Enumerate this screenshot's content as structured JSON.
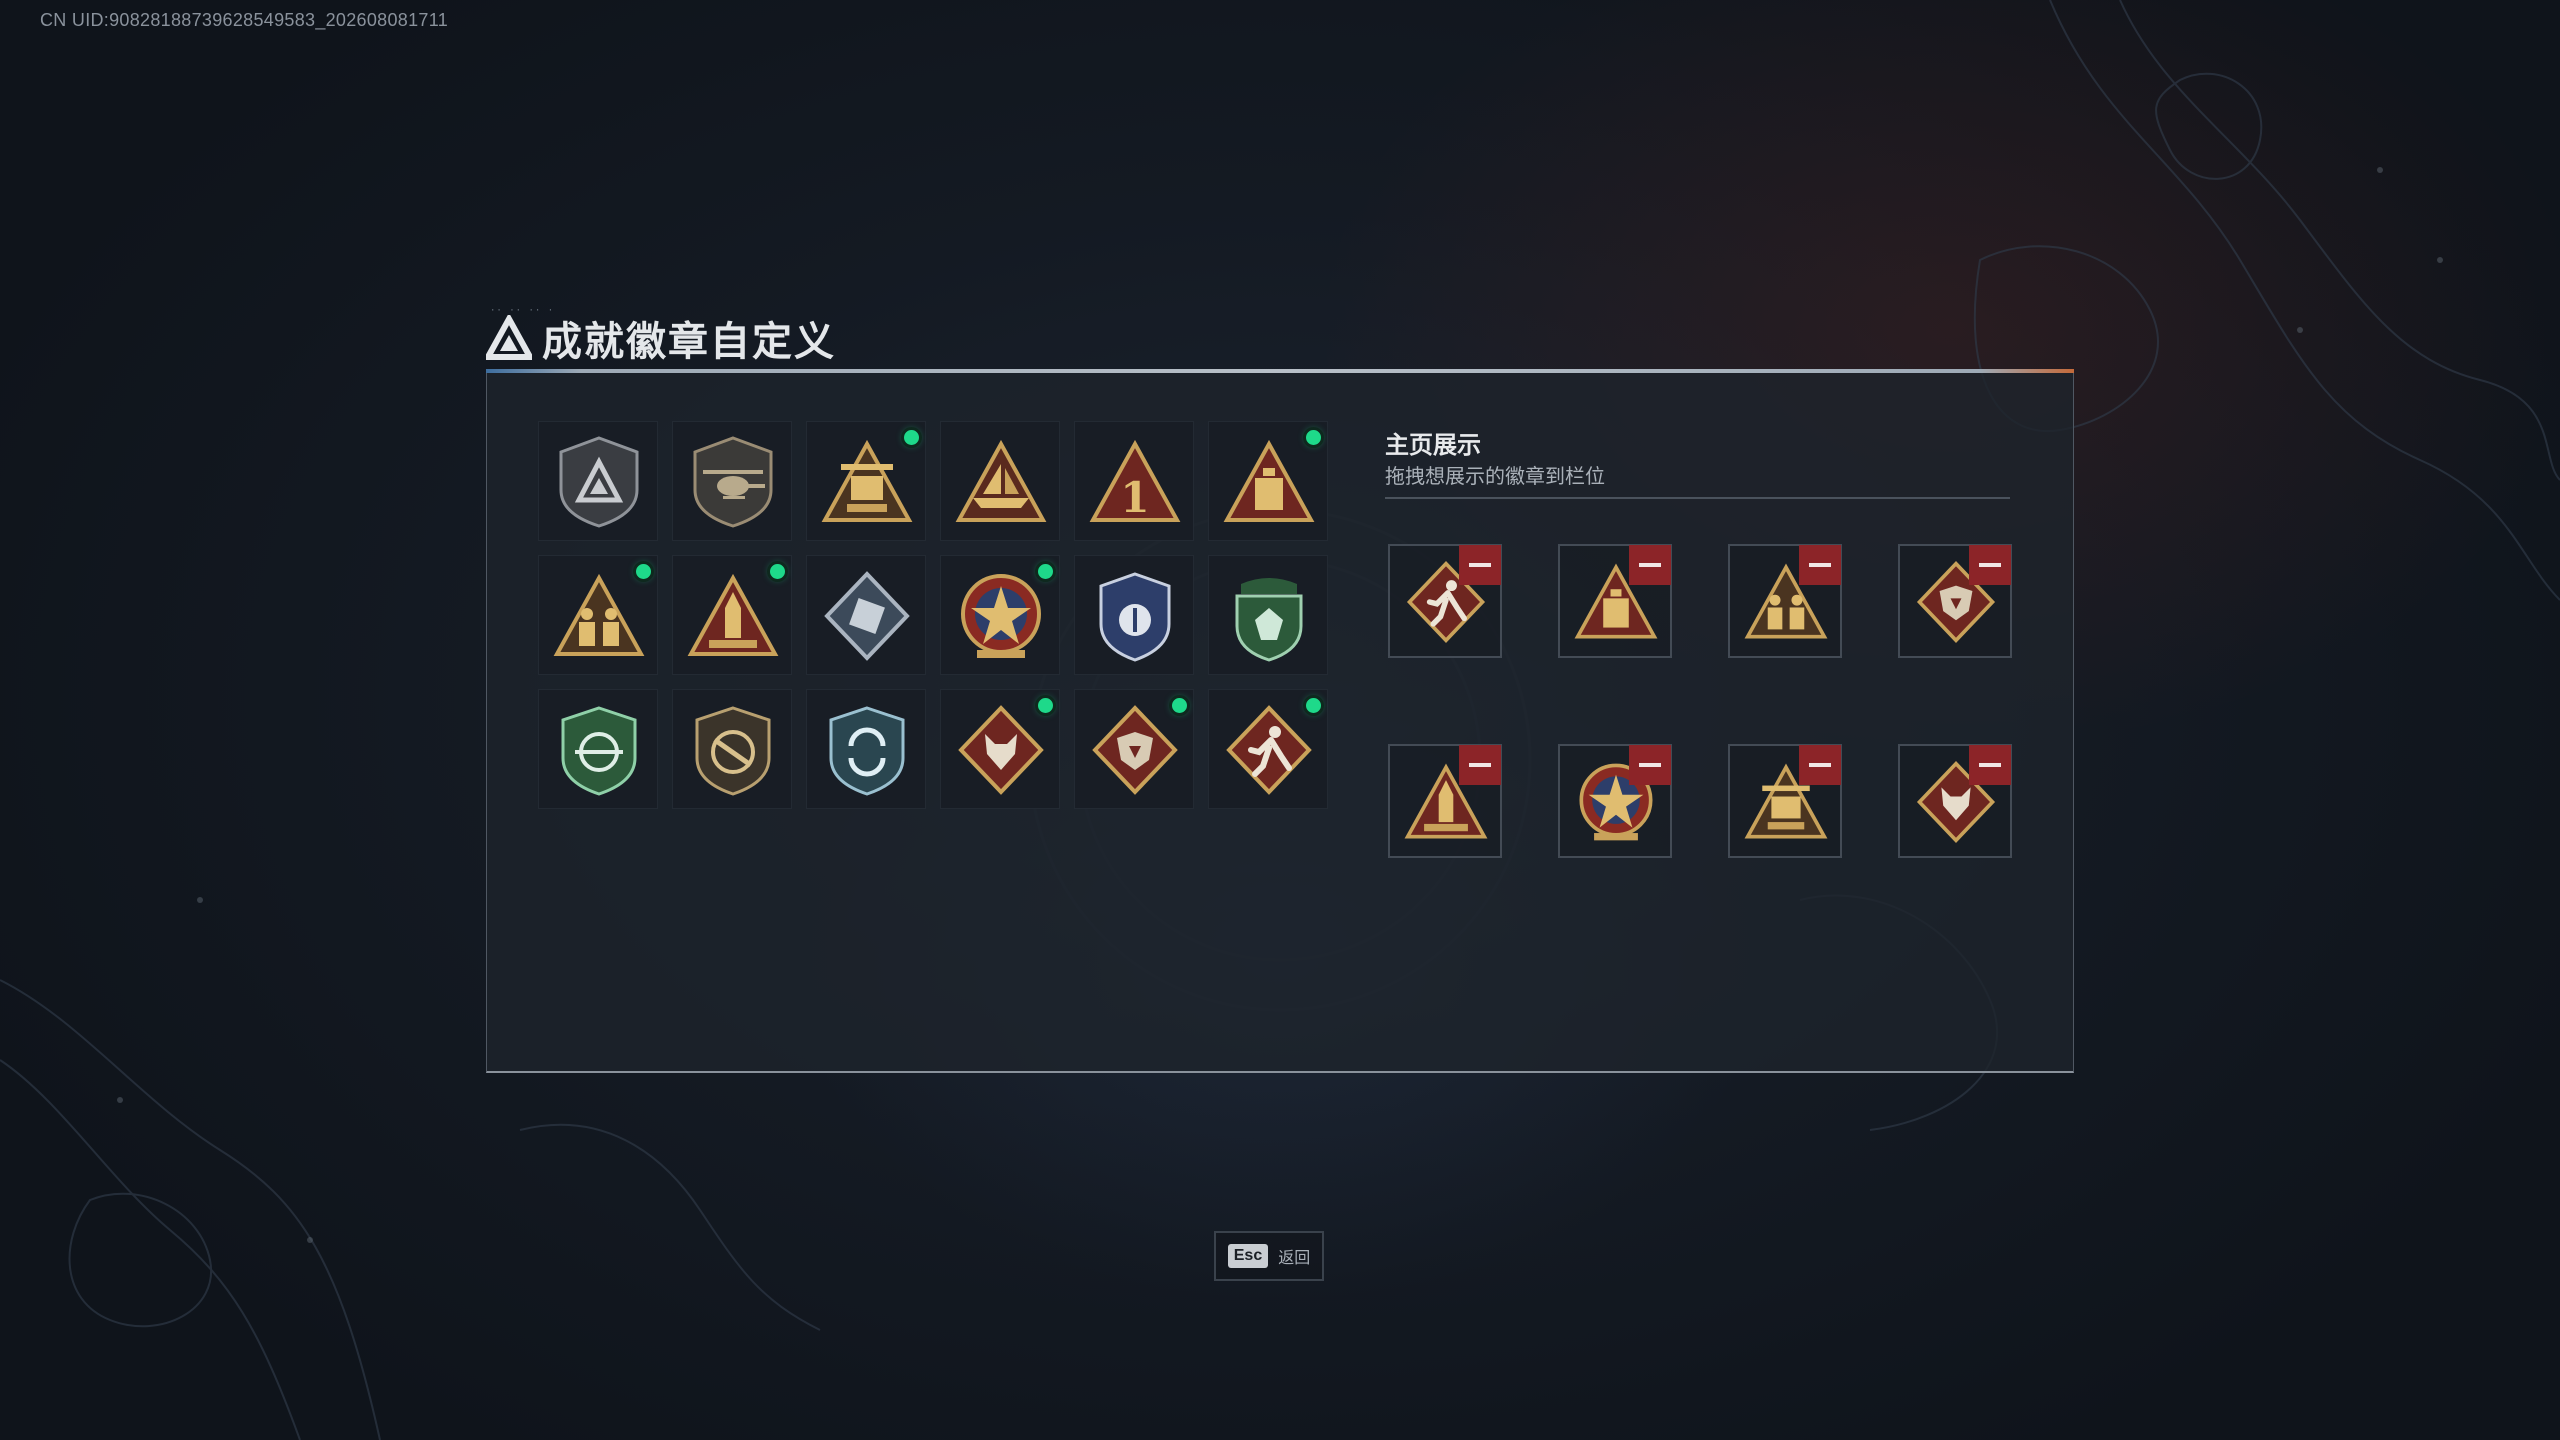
{
  "uid": "CN UID:9082818873962854958З_202608081711",
  "title": "成就徽章自定义",
  "showcase": {
    "title": "主页展示",
    "subtitle": "拖拽想展示的徽章到栏位"
  },
  "footer": {
    "key": "Esc",
    "label": "返回"
  },
  "badges": [
    {
      "icon": "shield-delta-icon",
      "new": false
    },
    {
      "icon": "helicopter-shield-icon",
      "new": false
    },
    {
      "icon": "turret-triangle-icon",
      "new": true
    },
    {
      "icon": "ship-triangle-icon",
      "new": false
    },
    {
      "icon": "number-one-triangle-icon",
      "new": false
    },
    {
      "icon": "box-triangle-icon",
      "new": true
    },
    {
      "icon": "soldiers-triangle-icon",
      "new": true
    },
    {
      "icon": "rocket-triangle-icon",
      "new": true
    },
    {
      "icon": "armor-diamond-icon",
      "new": false
    },
    {
      "icon": "star-emblem-icon",
      "new": true
    },
    {
      "icon": "police-shield-icon",
      "new": false
    },
    {
      "icon": "green-beret-shield-icon",
      "new": false
    },
    {
      "icon": "green-crosshair-shield-icon",
      "new": false
    },
    {
      "icon": "crossed-guns-shield-icon",
      "new": false
    },
    {
      "icon": "recycle-shield-icon",
      "new": false
    },
    {
      "icon": "wolf-diamond-icon",
      "new": true
    },
    {
      "icon": "dragon-diamond-icon",
      "new": true
    },
    {
      "icon": "runner-diamond-icon",
      "new": true
    }
  ],
  "slots": [
    {
      "icon": "runner-diamond-icon"
    },
    {
      "icon": "box-triangle-icon"
    },
    {
      "icon": "soldiers-triangle-icon"
    },
    {
      "icon": "dragon-diamond-icon"
    },
    {
      "icon": "rocket-triangle-icon"
    },
    {
      "icon": "star-emblem-icon"
    },
    {
      "icon": "turret-triangle-icon"
    },
    {
      "icon": "wolf-diamond-icon"
    }
  ],
  "colors": {
    "new_indicator": "#1ed98a",
    "remove_button": "#8c2428",
    "gold": "#c9a25a",
    "maroon_badge": "#6e2620",
    "green_badge": "#2c5a3a",
    "blue_badge": "#2d3e6a"
  }
}
